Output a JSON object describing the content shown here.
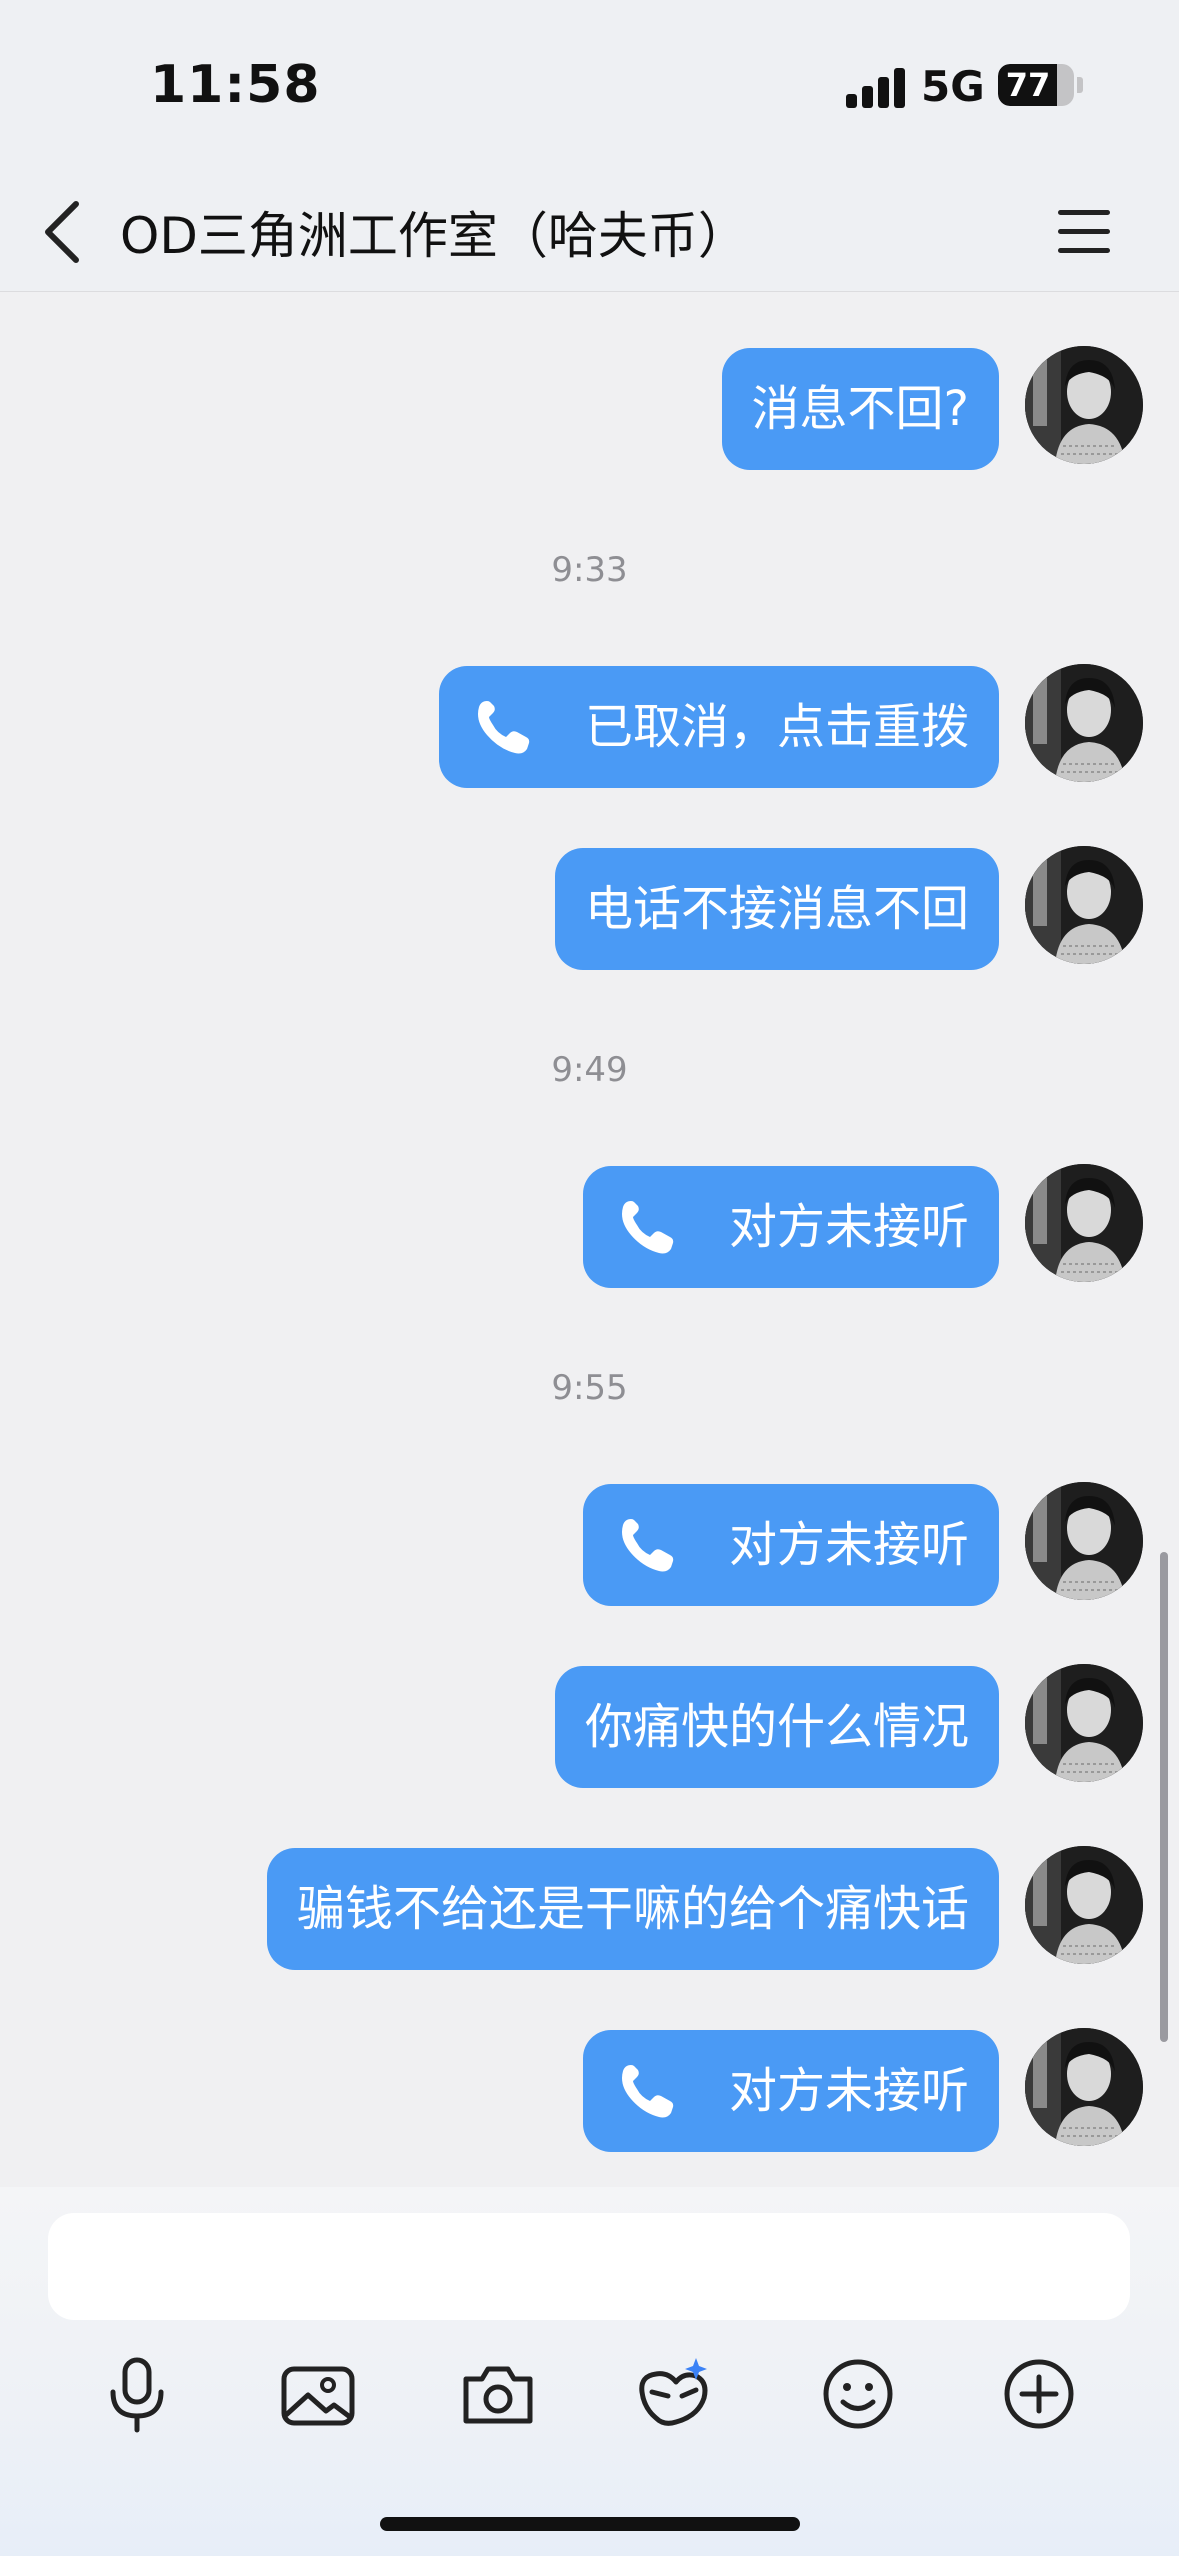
{
  "status_bar": {
    "time": "11:58",
    "network": "5G",
    "battery": "77",
    "battery_level": 0.77
  },
  "header": {
    "title": "OD三角洲工作室（哈夫币）"
  },
  "messages": [
    {
      "type": "text",
      "text": "消息不回?"
    },
    {
      "type": "timestamp",
      "text": "9:33"
    },
    {
      "type": "call",
      "text": "已取消，点击重拨",
      "icon": "phone-icon"
    },
    {
      "type": "text",
      "text": "电话不接消息不回"
    },
    {
      "type": "timestamp",
      "text": "9:49"
    },
    {
      "type": "call",
      "text": "对方未接听",
      "icon": "phone-icon"
    },
    {
      "type": "timestamp",
      "text": "9:55"
    },
    {
      "type": "call",
      "text": "对方未接听",
      "icon": "phone-icon"
    },
    {
      "type": "text",
      "text": "你痛快的什么情况"
    },
    {
      "type": "text",
      "text": "骗钱不给还是干嘛的给个痛快话"
    },
    {
      "type": "call",
      "text": "对方未接听",
      "icon": "phone-icon"
    }
  ],
  "toolbar": {
    "icons": [
      "microphone-icon",
      "image-icon",
      "camera-icon",
      "sticker-icon",
      "emoji-icon",
      "plus-icon"
    ]
  },
  "colors": {
    "bubble": "#4a9af5",
    "background": "#f0f0f2",
    "timestamp": "#8e8e93"
  }
}
